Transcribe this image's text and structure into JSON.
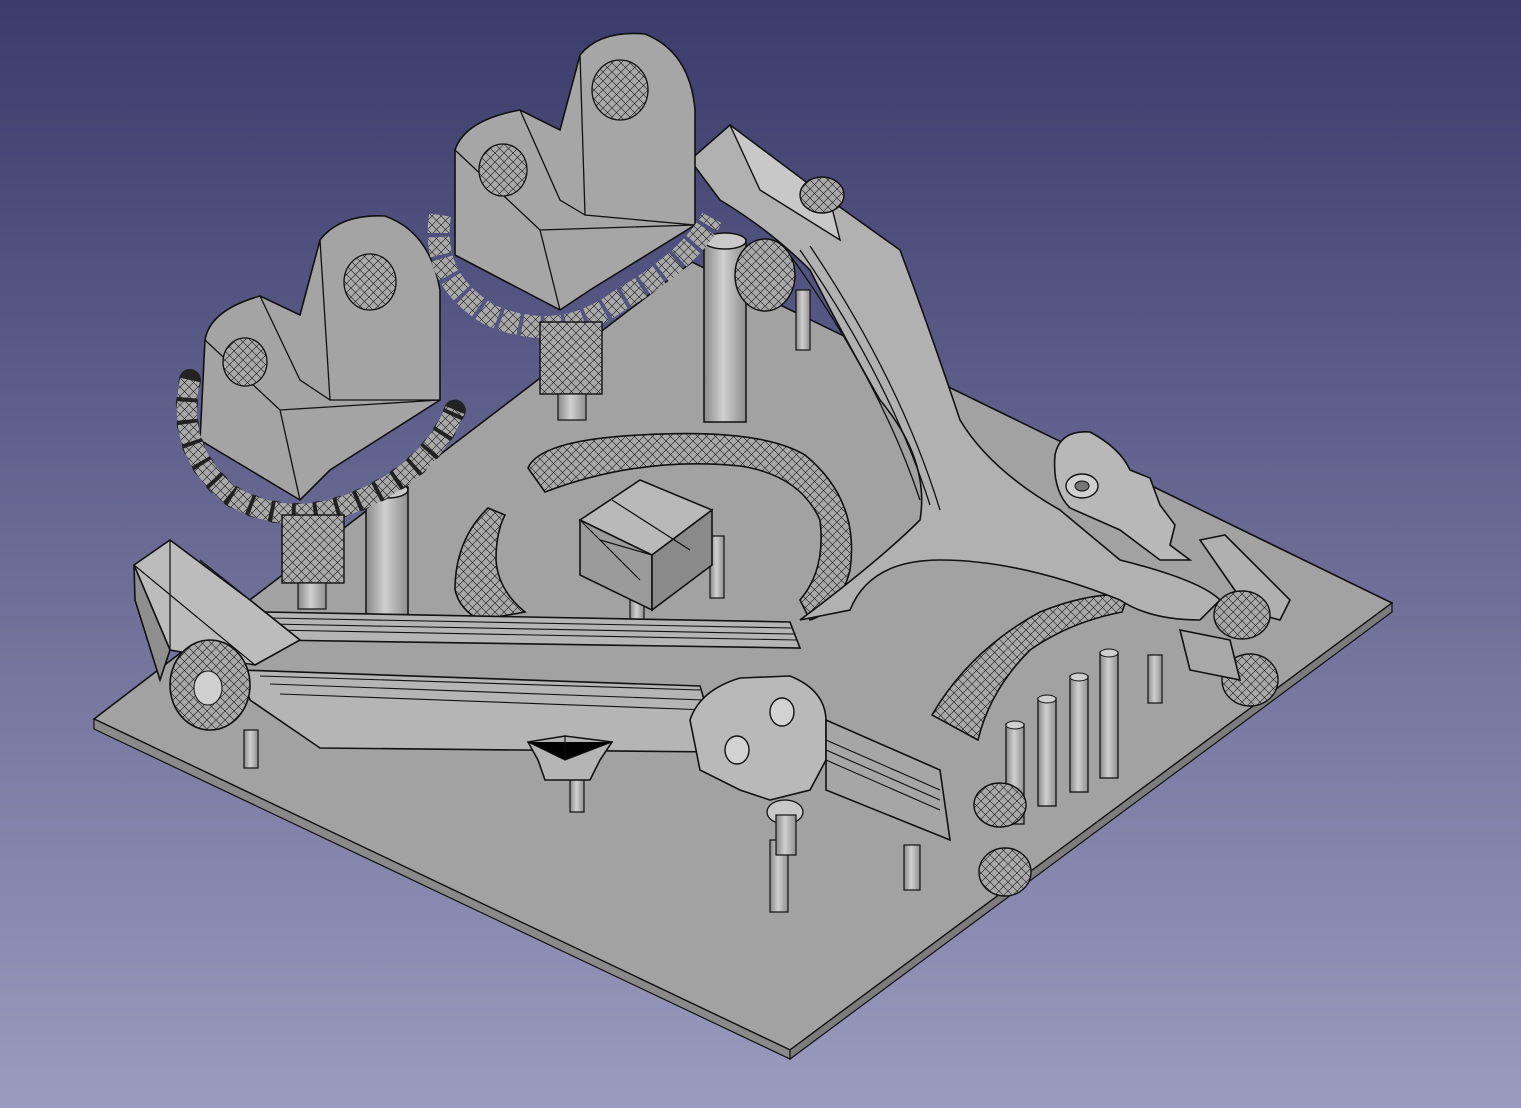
{
  "viewport": {
    "background_top": "#3b3b6c",
    "background_bottom": "#9b9bbf",
    "model_fill": "#a6a6a6",
    "model_fill_light": "#c4c4c4",
    "model_fill_dark": "#7e7e7e",
    "edge_color": "#111111",
    "view": "axonometric",
    "display_mode": "flat lines"
  }
}
